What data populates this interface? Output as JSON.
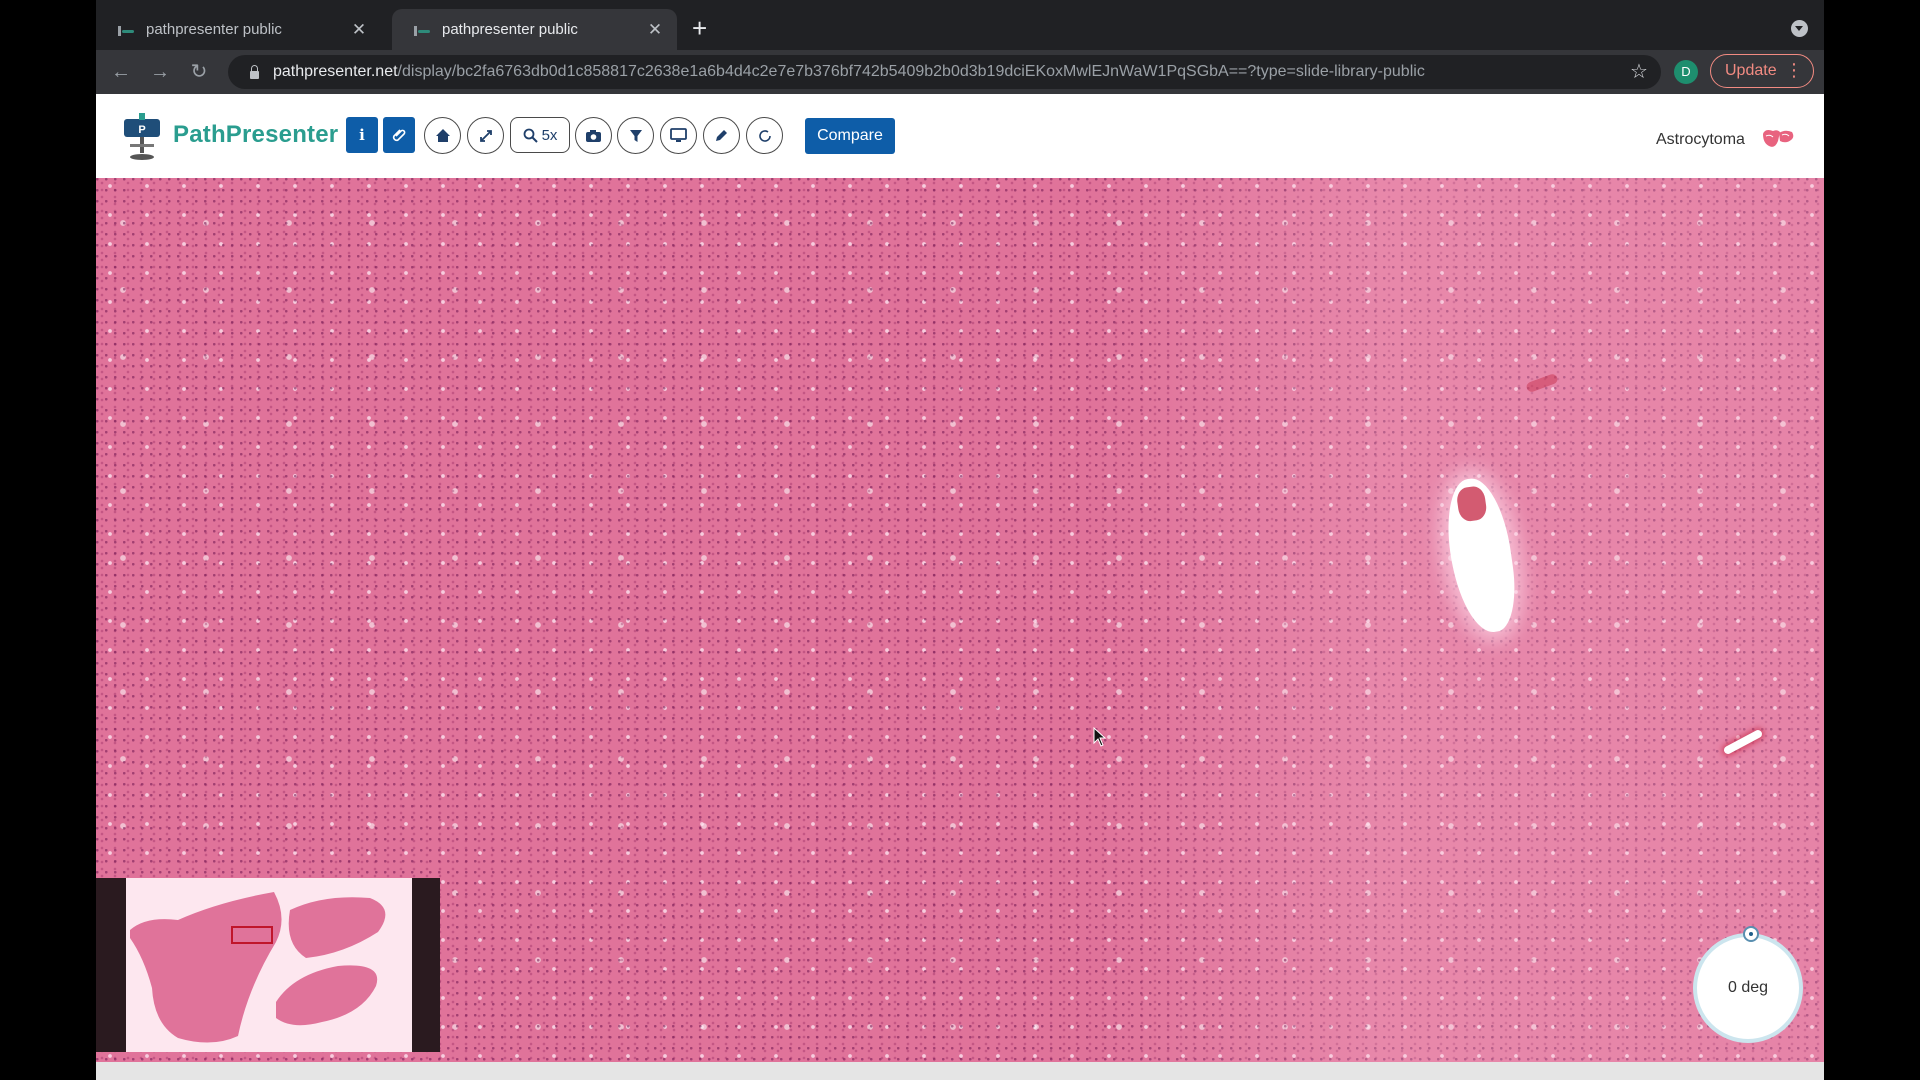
{
  "browser": {
    "tabs": [
      {
        "title": "pathpresenter public",
        "close": "✕",
        "active": false
      },
      {
        "title": "pathpresenter public",
        "close": "✕",
        "active": true
      }
    ],
    "new_tab": "+",
    "url_host": "pathpresenter.net",
    "url_path": "/display/bc2fa6763db0d1c858817c2638e1a6b4d4c2e7e7b376bf742b5409b2b0d3b19dciEKoxMwlEJnWaW1PqSGbA==?type=slide-library-public",
    "profile_initial": "D",
    "update_label": "Update"
  },
  "app": {
    "brand": "PathPresenter",
    "zoom_label": "5x",
    "compare_label": "Compare",
    "slide_name": "Astrocytoma",
    "toolbar_icons": [
      "info-icon",
      "paperclip-icon",
      "home-icon",
      "expand-icon",
      "zoom-icon",
      "camera-icon",
      "filter-icon",
      "monitor-icon",
      "pen-icon",
      "rotate-icon"
    ]
  },
  "viewer": {
    "rotation_label": "0 deg",
    "tissue_color": "#e0739a"
  }
}
